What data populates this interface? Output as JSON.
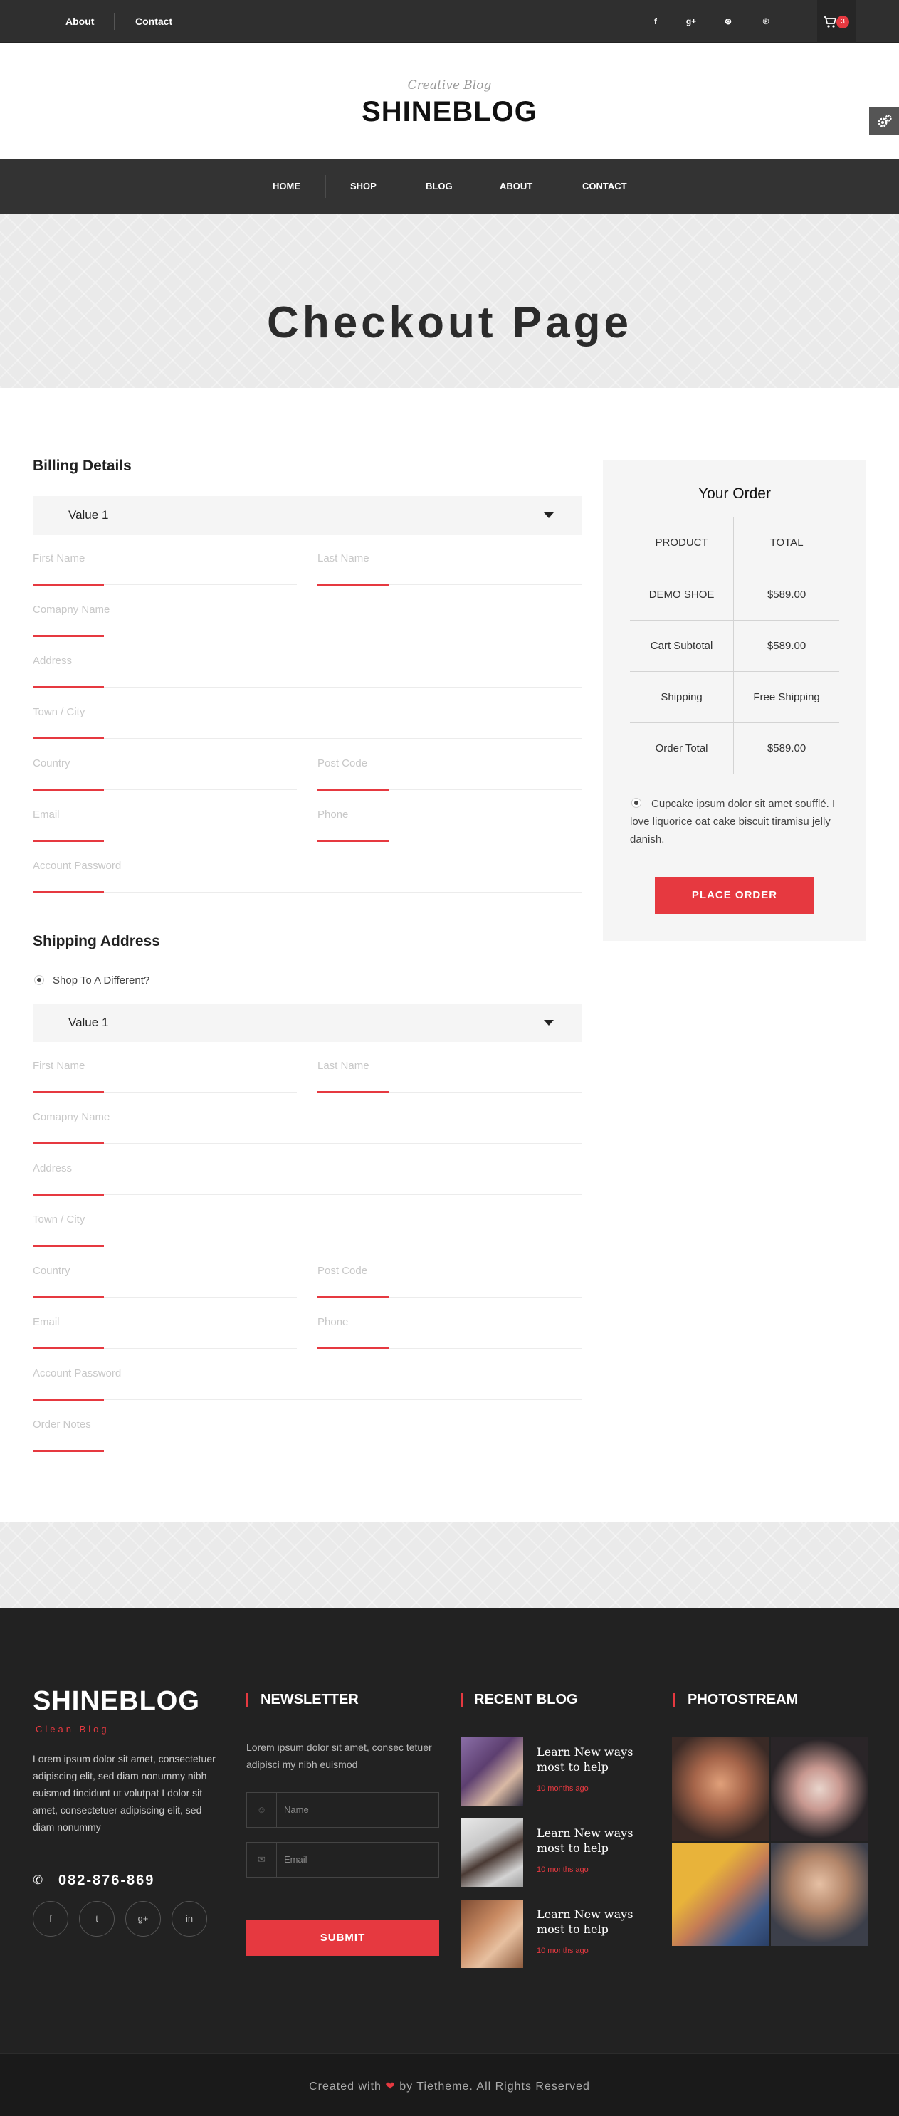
{
  "topbar": {
    "links": [
      "About",
      "Contact"
    ],
    "social_icons": [
      "facebook-icon",
      "google-plus-icon",
      "dribbble-icon",
      "pinterest-icon"
    ],
    "social_glyphs": [
      "f",
      "g+",
      "⊛",
      "℗"
    ],
    "cart_count": "3"
  },
  "header": {
    "tagline": "Creative Blog",
    "logo": "SHINEBLOG"
  },
  "nav": {
    "items": [
      "HOME",
      "SHOP",
      "BLOG",
      "ABOUT",
      "CONTACT"
    ]
  },
  "banner": {
    "title": "Checkout Page"
  },
  "billing": {
    "title": "Billing Details",
    "select_value": "Value 1",
    "placeholders": {
      "first_name": "First Name",
      "last_name": "Last Name",
      "company": "Comapny Name",
      "address": "Address",
      "town": "Town / City",
      "country": "Country",
      "post_code": "Post Code",
      "email": "Email",
      "phone": "Phone",
      "password": "Account Password"
    }
  },
  "shipping": {
    "title": "Shipping Address",
    "ship_different_label": "Shop To A Different?",
    "select_value": "Value 1",
    "placeholders": {
      "first_name": "First Name",
      "last_name": "Last Name",
      "company": "Comapny Name",
      "address": "Address",
      "town": "Town / City",
      "country": "Country",
      "post_code": "Post Code",
      "email": "Email",
      "phone": "Phone",
      "password": "Account Password",
      "notes": "Order Notes"
    }
  },
  "order": {
    "title": "Your Order",
    "headers": [
      "PRODUCT",
      "TOTAL"
    ],
    "rows": [
      [
        "DEMO SHOE",
        "$589.00"
      ],
      [
        "Cart Subtotal",
        "$589.00"
      ],
      [
        "Shipping",
        "Free Shipping"
      ],
      [
        "Order Total",
        "$589.00"
      ]
    ],
    "terms": "Cupcake ipsum dolor sit amet soufflé. I love liquorice oat cake biscuit tiramisu jelly danish.",
    "place_order": "PLACE ORDER"
  },
  "footer": {
    "logo": "SHINEBLOG",
    "tagline": "Clean Blog",
    "description": "Lorem ipsum dolor sit amet, consectetuer adipiscing elit, sed diam nonummy nibh euismod tincidunt ut volutpat Ldolor sit amet, consectetuer adipiscing elit, sed diam nonummy",
    "phone": "082-876-869",
    "social_glyphs": [
      "f",
      "t",
      "g+",
      "in"
    ],
    "newsletter": {
      "title": "NEWSLETTER",
      "text": "Lorem ipsum dolor sit amet, consec tetuer adipisci my nibh euismod",
      "name_placeholder": "Name",
      "email_placeholder": "Email",
      "submit": "SUBMIT"
    },
    "recent_blog": {
      "title": "RECENT BLOG",
      "posts": [
        {
          "title": "Learn New ways most to help",
          "date": "10 months ago"
        },
        {
          "title": "Learn New ways most to help",
          "date": "10 months ago"
        },
        {
          "title": "Learn New ways most to help",
          "date": "10 months ago"
        }
      ]
    },
    "photostream": {
      "title": "PHOTOSTREAM"
    }
  },
  "copyright": {
    "before": "Created with",
    "after": "by Tietheme. All Rights Reserved"
  },
  "colors": {
    "accent": "#e63940",
    "dark": "#2f2f2f",
    "footer": "#222222"
  }
}
